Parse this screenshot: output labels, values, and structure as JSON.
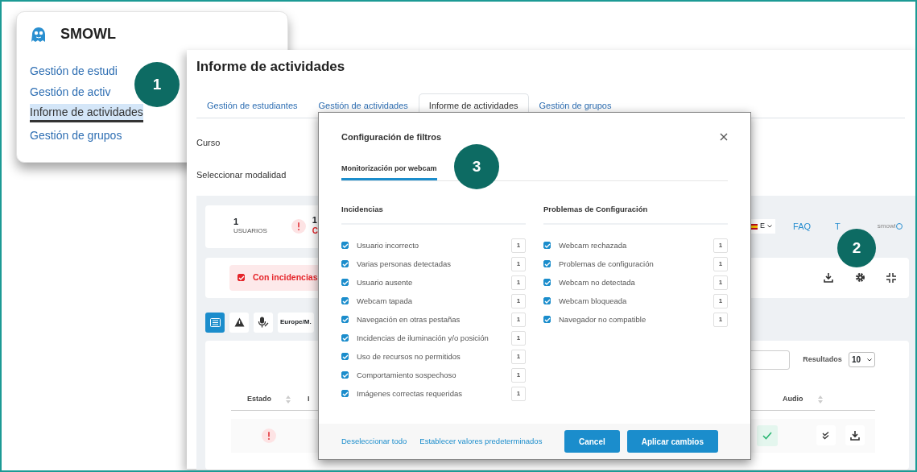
{
  "sidebar_card": {
    "brand": "SMOWL",
    "items": [
      {
        "label": "Gestión de estudi",
        "selected": false
      },
      {
        "label": "Gestión de activ",
        "selected": false
      },
      {
        "label": "Informe de actividades",
        "selected": true
      },
      {
        "label": "Gestión de grupos",
        "selected": false
      }
    ]
  },
  "page": {
    "title": "Informe de actividades",
    "tabs": [
      {
        "label": "Gestión de estudiantes",
        "selected": false
      },
      {
        "label": "Gestión de actividades",
        "selected": false
      },
      {
        "label": "Informe de actividades",
        "selected": true
      },
      {
        "label": "Gestión de grupos",
        "selected": false
      }
    ],
    "fields": [
      "Curso",
      "Seleccionar modalidad"
    ],
    "stats": [
      {
        "kind": "plain",
        "value": "1",
        "label": "USUARIOS"
      },
      {
        "kind": "alert",
        "value": "1",
        "label": "C"
      }
    ],
    "language": "E",
    "links": [
      "FAQ",
      "T"
    ],
    "logo_text": "smowl",
    "filter_chip": {
      "label": "Con incidencias",
      "checked": true
    },
    "view_buttons": [
      {
        "kind": "list",
        "selected": true
      },
      {
        "kind": "warning",
        "selected": false
      },
      {
        "kind": "mic",
        "selected": false
      }
    ],
    "timezone": "Europe/M.",
    "results_label": "Resultados",
    "results_value": "10",
    "columns": [
      "Estado",
      "I",
      "Audio"
    ],
    "rows": [
      {
        "kind": "alert",
        "audio_ok": true
      }
    ]
  },
  "modal": {
    "title": "Configuración de filtros",
    "tabs": [
      {
        "label": "Monitorización por webcam",
        "selected": true
      }
    ],
    "groups": [
      {
        "title": "Incidencias",
        "items": [
          {
            "label": "Usuario incorrecto",
            "checked": true,
            "count": "1"
          },
          {
            "label": "Varias personas detectadas",
            "checked": true,
            "count": "1"
          },
          {
            "label": "Usuario ausente",
            "checked": true,
            "count": "1"
          },
          {
            "label": "Webcam tapada",
            "checked": true,
            "count": "1"
          },
          {
            "label": "Navegación en otras pestañas",
            "checked": true,
            "count": "1"
          },
          {
            "label": "Incidencias de iluminación y/o posición",
            "checked": true,
            "count": "1"
          },
          {
            "label": "Uso de recursos no permitidos",
            "checked": true,
            "count": "1"
          },
          {
            "label": "Comportamiento sospechoso",
            "checked": true,
            "count": "1"
          },
          {
            "label": "Imágenes correctas requeridas",
            "checked": true,
            "count": "1"
          }
        ]
      },
      {
        "title": "Problemas de Configuración",
        "items": [
          {
            "label": "Webcam rechazada",
            "checked": true,
            "count": "1"
          },
          {
            "label": "Problemas de configuración",
            "checked": true,
            "count": "1"
          },
          {
            "label": "Webcam no detectada",
            "checked": true,
            "count": "1"
          },
          {
            "label": "Webcam bloqueada",
            "checked": true,
            "count": "1"
          },
          {
            "label": "Navegador no compatible",
            "checked": true,
            "count": "1"
          }
        ]
      }
    ],
    "links": [
      "Deseleccionar todo",
      "Establecer valores predeterminados"
    ],
    "buttons": [
      "Cancel",
      "Aplicar cambios"
    ]
  },
  "callouts": [
    "1",
    "2",
    "3"
  ]
}
